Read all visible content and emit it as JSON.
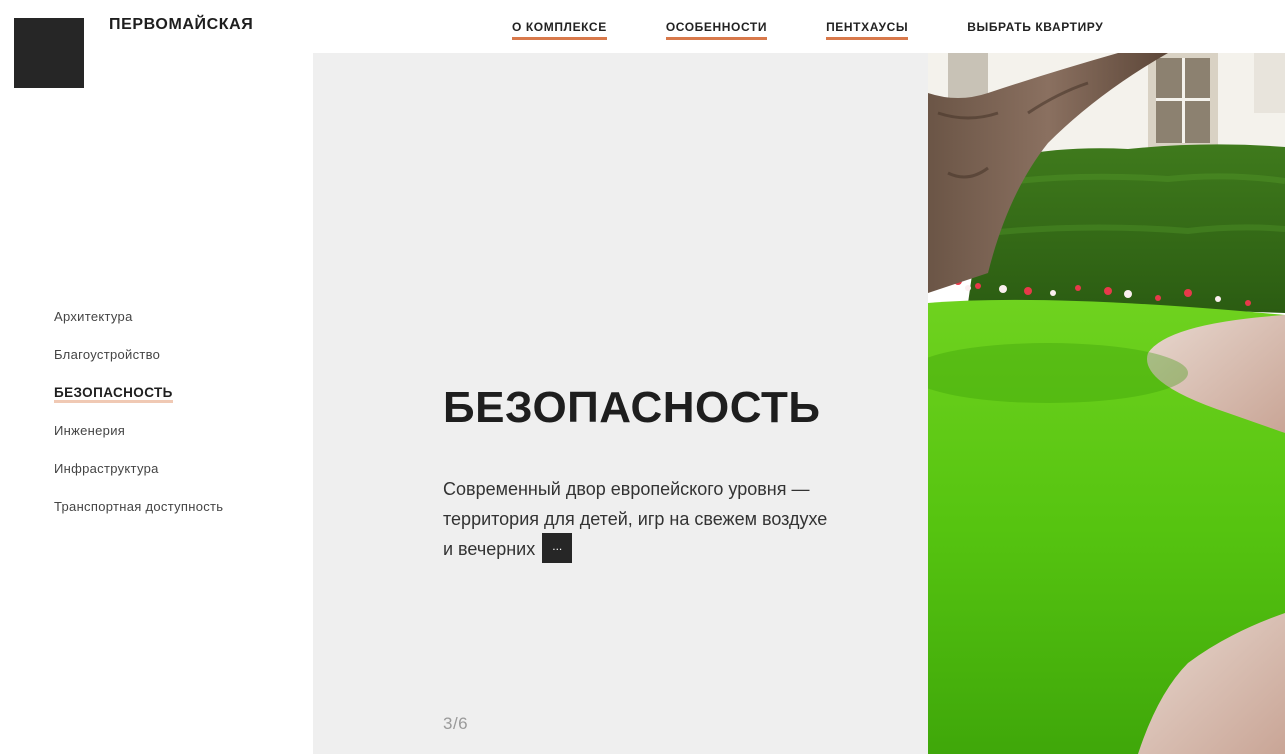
{
  "brand": {
    "name": "ПЕРВОМАЙСКАЯ"
  },
  "top_nav": [
    {
      "label": "О КОМПЛЕКСЕ"
    },
    {
      "label": "ОСОБЕННОСТИ"
    },
    {
      "label": "ПЕНТХАУСЫ"
    },
    {
      "label": "ВЫБРАТЬ КВАРТИРУ"
    }
  ],
  "side_nav": [
    {
      "label": "Архитектура"
    },
    {
      "label": "Благоустройство"
    },
    {
      "label": "БЕЗОПАСНОСТЬ"
    },
    {
      "label": "Инженерия"
    },
    {
      "label": "Инфраструктура"
    },
    {
      "label": "Транспортная доступность"
    }
  ],
  "section": {
    "title": "БЕЗОПАСНОСТЬ",
    "text": "Современный двор европейского уровня — территория для детей, игр на свежем воздухе и вечерних",
    "more_label": "...",
    "counter": "3/6"
  },
  "colors": {
    "accent": "#d8794b",
    "panel_bg": "#efefef",
    "dark": "#262626"
  }
}
